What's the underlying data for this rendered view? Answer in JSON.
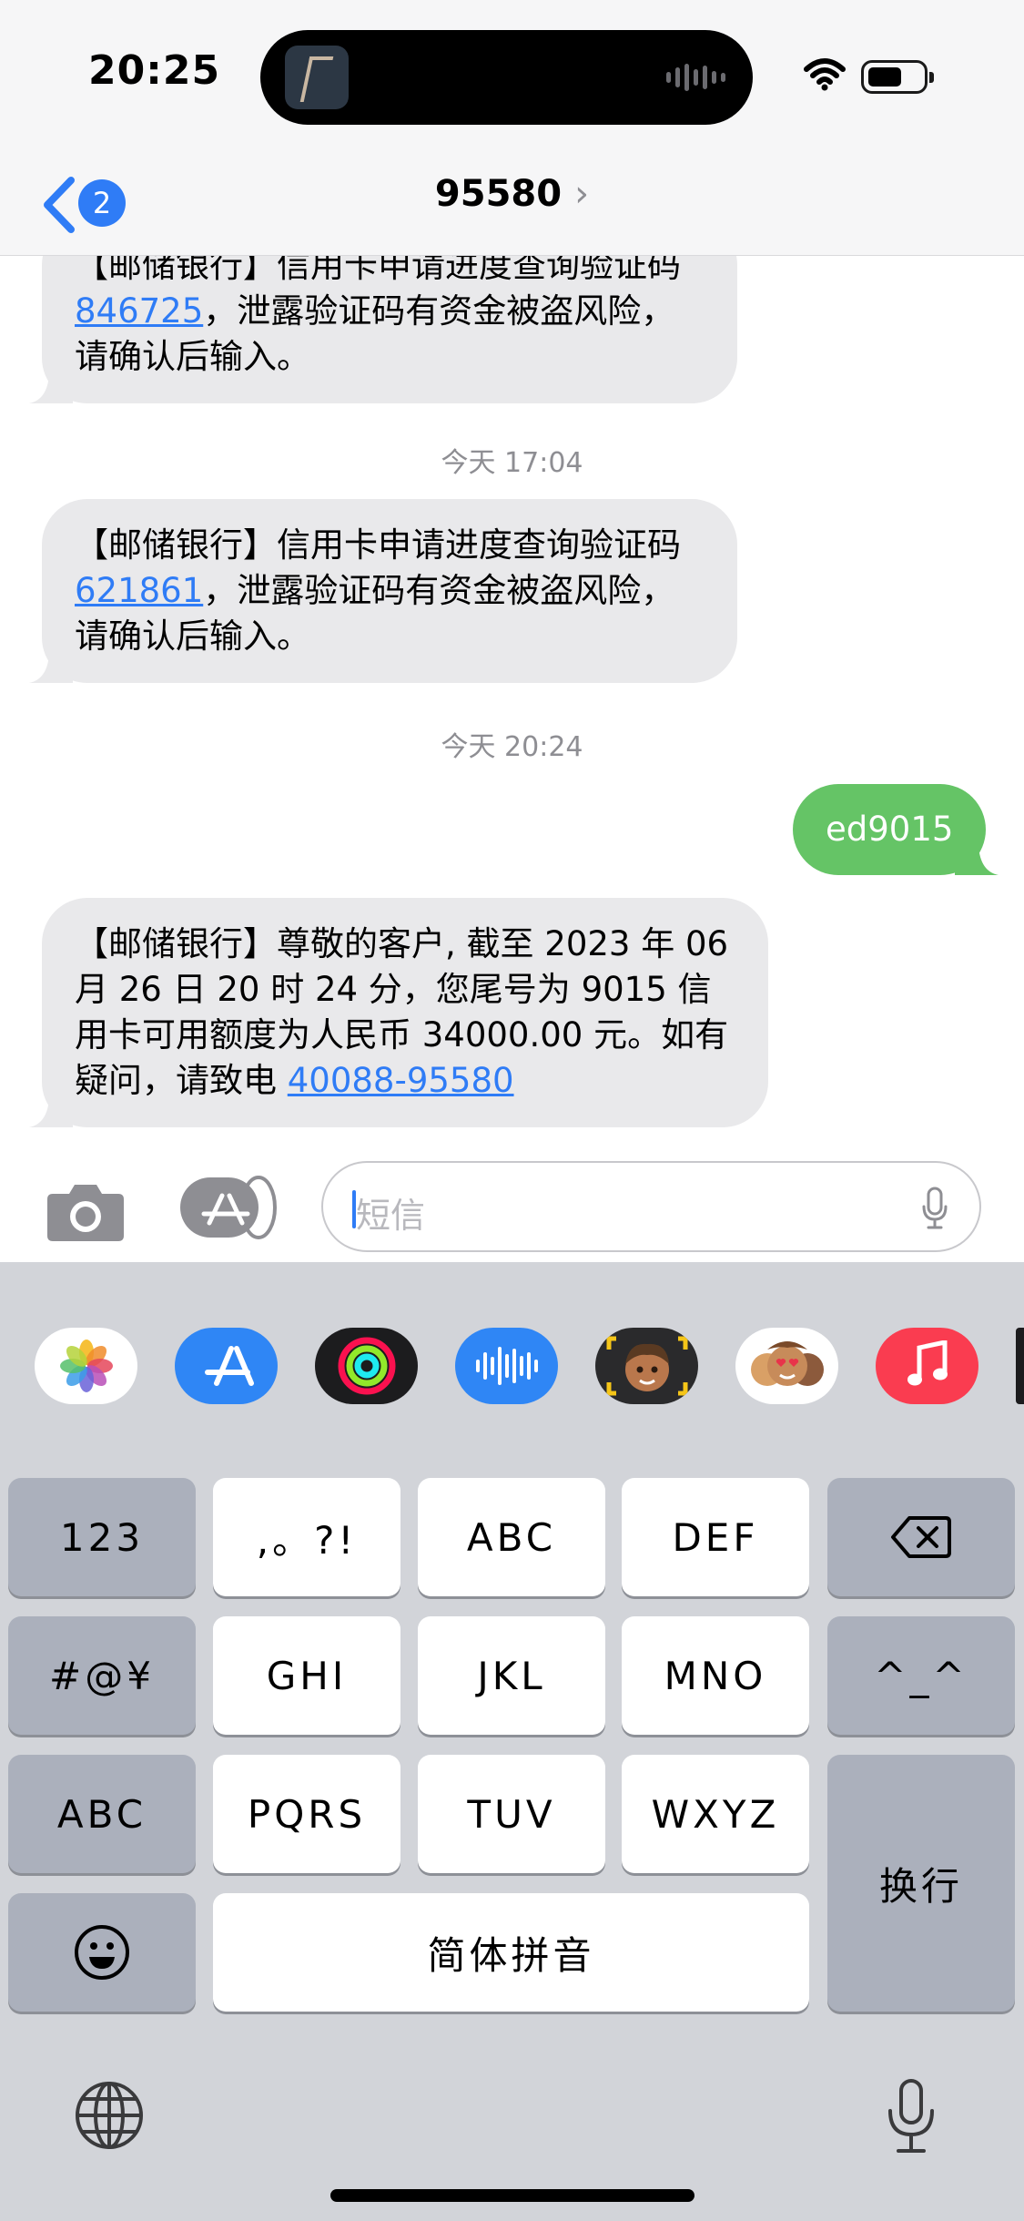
{
  "status": {
    "time": "20:25",
    "island_icon": "now-playing-artwork",
    "wifi_icon": "wifi-icon",
    "battery_icon": "battery-icon"
  },
  "nav": {
    "back_badge": "2",
    "title": "95580",
    "title_chevron": "›"
  },
  "messages": [
    {
      "text_a": "【邮储银行】信用卡申请进度查询验证码 ",
      "code": "846725",
      "text_b": "，泄露验证码有资金被盗风险，请确认后输入。"
    },
    {
      "timestamp": "今天 17:04"
    },
    {
      "text_a": "【邮储银行】信用卡申请进度查询验证码 ",
      "code": "621861",
      "text_b": "，泄露验证码有资金被盗风险，请确认后输入。"
    },
    {
      "timestamp": "今天 20:24"
    },
    {
      "sent": "ed9015"
    },
    {
      "text_a": "【邮储银行】尊敬的客户, 截至 2023 年 06 月 26 日 20 时 24 分，您尾号为 9015 信用卡可用额度为人民币 34000.00 元。如有疑问，请致电 ",
      "phone": "40088-95580"
    }
  ],
  "input": {
    "placeholder": "短信"
  },
  "app_strip": [
    "photos-icon",
    "app-store-icon",
    "fitness-icon",
    "audio-message-icon",
    "memoji-icon",
    "memoji-stickers-icon",
    "music-icon"
  ],
  "keyboard": {
    "row1": [
      "123",
      ",。?!",
      "ABC",
      "DEF",
      "delete"
    ],
    "row2": [
      "#@¥",
      "GHI",
      "JKL",
      "MNO",
      "^_^"
    ],
    "row3": [
      "ABC",
      "PQRS",
      "TUV",
      "WXYZ"
    ],
    "return": "换行",
    "space": "简体拼音",
    "emoji": "emoji-icon",
    "globe": "globe-icon",
    "dictation": "mic-icon"
  },
  "colors": {
    "accent": "#2f7cf6",
    "sent_bubble": "#65c466",
    "received_bubble": "#e9e9eb",
    "keyboard_bg": "#d2d4d9"
  }
}
